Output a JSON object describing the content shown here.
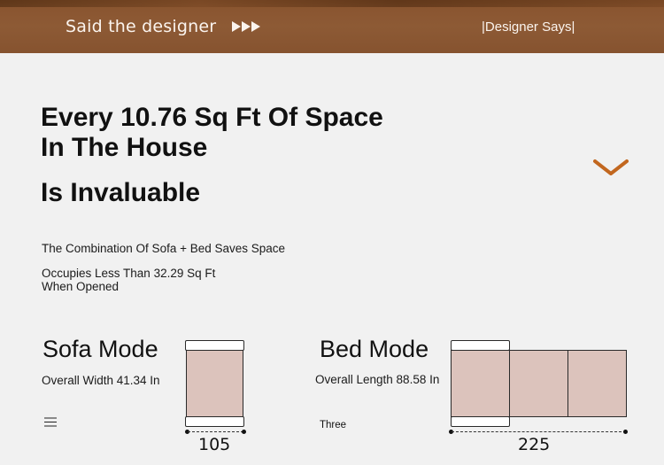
{
  "banner": {
    "left_text": "Said the designer",
    "right_text": "|Designer Says|"
  },
  "headline": {
    "line1": "Every 10.76 Sq Ft Of Space",
    "line2": "In The House",
    "line3": "Is Invaluable"
  },
  "copy": {
    "combination": "The Combination Of Sofa + Bed Saves Space",
    "occupies_line1": "Occupies Less Than 32.29 Sq Ft",
    "occupies_line2": "When Opened"
  },
  "sofa_mode": {
    "title": "Sofa Mode",
    "subtitle": "Overall Width 41.34 In",
    "dimension": "105"
  },
  "bed_mode": {
    "title": "Bed Mode",
    "subtitle": "Overall Length 88.58 In",
    "label": "Three",
    "dimension": "225"
  },
  "icons": {
    "arrows": "triple-play-arrow-icon",
    "chevron": "chevron-down-icon",
    "menu": "menu-icon"
  },
  "colors": {
    "banner": "#8d5a35",
    "background": "#f1f1f1",
    "cushion": "#dcc3bc",
    "chevron": "#c2671f"
  }
}
